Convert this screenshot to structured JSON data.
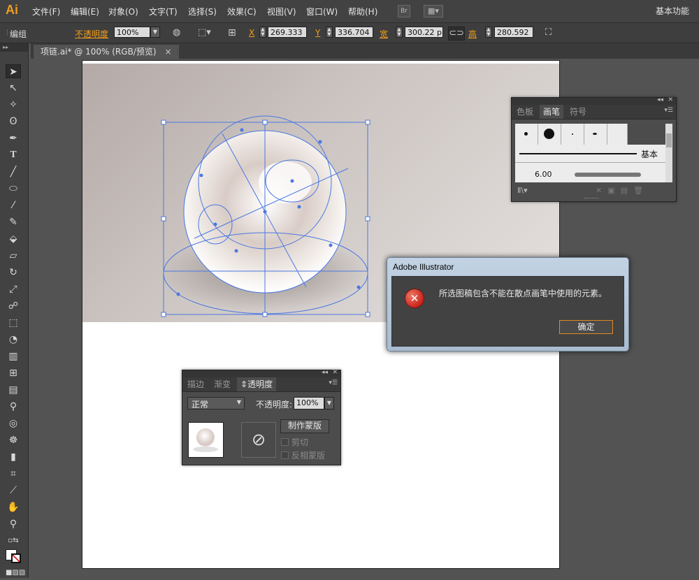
{
  "app": {
    "logo": "Ai"
  },
  "menu": {
    "items": [
      "文件(F)",
      "编辑(E)",
      "对象(O)",
      "文字(T)",
      "选择(S)",
      "效果(C)",
      "视图(V)",
      "窗口(W)",
      "帮助(H)"
    ],
    "bridge_label": "Br",
    "workspace": "基本功能"
  },
  "control": {
    "group_label": "编组",
    "opacity_label": "不透明度",
    "opacity_value": "100%",
    "x_label": "X",
    "x_value": "269.333",
    "y_label": "Y",
    "y_value": "336.704",
    "w_label": "宽",
    "w_value": "300.22 p",
    "h_label": "高",
    "h_value": "280.592"
  },
  "document": {
    "tab_title": "项链.ai* @ 100% (RGB/预览)",
    "close_glyph": "×"
  },
  "brush_panel": {
    "tabs": [
      "色板",
      "画笔",
      "符号"
    ],
    "active_tab": "画笔",
    "basic_label": "基本",
    "size_value": "6.00"
  },
  "transparency_panel": {
    "tabs": [
      "描边",
      "渐变",
      "透明度"
    ],
    "active_tab": "透明度",
    "blend_mode": "正常",
    "opacity_label": "不透明度:",
    "opacity_value": "100%",
    "make_mask_label": "制作蒙版",
    "clip_label": "剪切",
    "invert_mask_label": "反相蒙版"
  },
  "dialog": {
    "title": "Adobe Illustrator",
    "message": "所选图稿包含不能在散点画笔中使用的元素。",
    "ok_label": "确定"
  },
  "colors": {
    "accent": "#f29e1b",
    "selection": "#4a78e0",
    "error": "#c8241a"
  }
}
